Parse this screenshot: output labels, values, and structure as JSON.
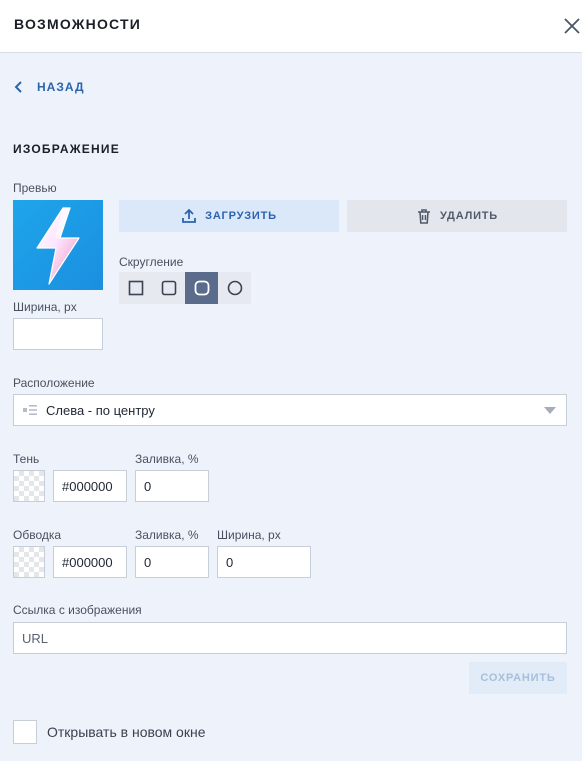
{
  "header": {
    "title": "ВОЗМОЖНОСТИ",
    "close_icon": "close-icon"
  },
  "nav": {
    "back_label": "НАЗАД"
  },
  "image_section": {
    "title": "ИЗОБРАЖЕНИЕ",
    "preview_label": "Превью",
    "upload_label": "ЗАГРУЗИТЬ",
    "delete_label": "УДАЛИТЬ",
    "rounding_label": "Скругление",
    "rounding_options": [
      "none",
      "small",
      "medium",
      "circle"
    ],
    "rounding_selected": "medium",
    "width_label": "Ширина, px",
    "width_value": ""
  },
  "position": {
    "label": "Расположение",
    "value": "Слева - по центру"
  },
  "shadow": {
    "label": "Тень",
    "color": "#000000",
    "fill_label": "Заливка, %",
    "fill_value": "0"
  },
  "border": {
    "label": "Обводка",
    "color": "#000000",
    "fill_label": "Заливка, %",
    "fill_value": "0",
    "width_label": "Ширина, px",
    "width_value": "0"
  },
  "link": {
    "label": "Ссылка с изображения",
    "placeholder": "URL"
  },
  "save_label": "СОХРАНИТЬ",
  "new_window": {
    "label": "Открывать в новом окне",
    "checked": false
  },
  "colors": {
    "accent": "#2a64ad",
    "background": "#eef3fb",
    "upload_bg": "#dbe8fa",
    "active_rounding": "#5a6b8c"
  }
}
